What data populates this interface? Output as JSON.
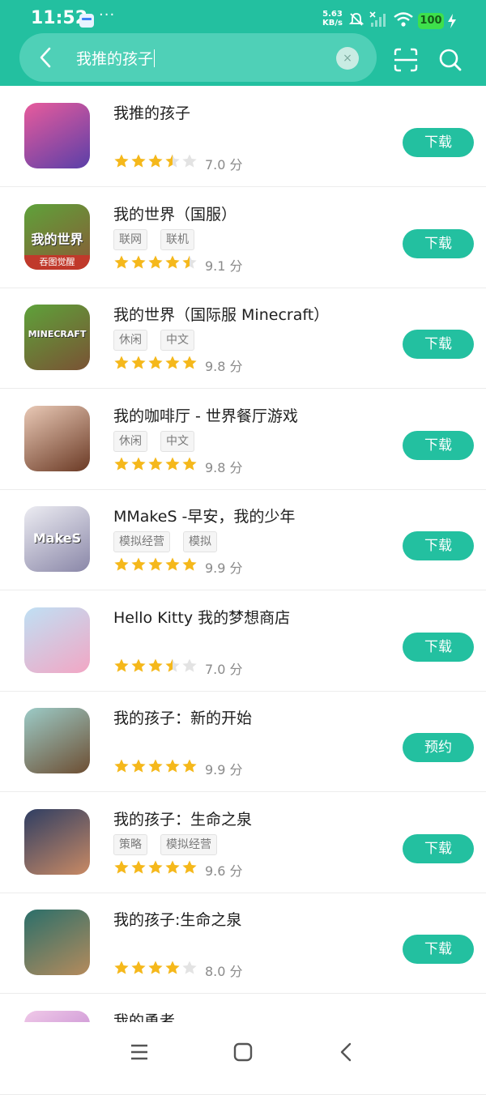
{
  "status_bar": {
    "time": "11:52",
    "dots": "···",
    "net_speed_value": "5.63",
    "net_speed_unit": "KB/s",
    "battery": "100"
  },
  "search": {
    "query": "我推的孩子",
    "clear_label": "×"
  },
  "apps": [
    {
      "name": "我推的孩子",
      "tags": [],
      "rating": 3.5,
      "score": "7.0 分",
      "button": "下载",
      "icon_colors": [
        "#e85b9c",
        "#5a3fa8"
      ]
    },
    {
      "name": "我的世界（国服）",
      "tags": [
        "联网",
        "联机"
      ],
      "rating": 4.5,
      "score": "9.1 分",
      "button": "下载",
      "icon_colors": [
        "#5ea23a",
        "#8a5a36"
      ],
      "icon_caption": "我的世界",
      "icon_badge": "吞图觉醒"
    },
    {
      "name": "我的世界（国际服 Minecraft）",
      "tags": [
        "休闲",
        "中文"
      ],
      "rating": 5,
      "score": "9.8 分",
      "button": "下载",
      "icon_colors": [
        "#5ea23a",
        "#7a5234"
      ],
      "icon_caption": "MINECRAFT"
    },
    {
      "name": "我的咖啡厅 - 世界餐厅游戏",
      "tags": [
        "休闲",
        "中文"
      ],
      "rating": 5,
      "score": "9.8 分",
      "button": "下载",
      "icon_colors": [
        "#e9c9b6",
        "#6b3a25"
      ]
    },
    {
      "name": "MMakeS -早安，我的少年",
      "tags": [
        "模拟经营",
        "模拟"
      ],
      "rating": 5,
      "score": "9.9 分",
      "button": "下载",
      "icon_colors": [
        "#ececf2",
        "#8a87a8"
      ],
      "icon_caption": "MakeS"
    },
    {
      "name": "Hello Kitty 我的梦想商店",
      "tags": [],
      "rating": 3.5,
      "score": "7.0 分",
      "button": "下载",
      "icon_colors": [
        "#bfe0f4",
        "#f2a6c4"
      ]
    },
    {
      "name": "我的孩子：新的开始",
      "tags": [],
      "rating": 5,
      "score": "9.9 分",
      "button": "预约",
      "icon_colors": [
        "#9ccbc7",
        "#6d4e32"
      ]
    },
    {
      "name": "我的孩子：生命之泉",
      "tags": [
        "策略",
        "模拟经营"
      ],
      "rating": 5,
      "score": "9.6 分",
      "button": "下载",
      "icon_colors": [
        "#2f3e63",
        "#c98a64"
      ]
    },
    {
      "name": "我的孩子:生命之泉",
      "tags": [],
      "rating": 4,
      "score": "8.0 分",
      "button": "下载",
      "icon_colors": [
        "#2b6f6a",
        "#b58b5c"
      ]
    },
    {
      "name": "我的勇者",
      "tags": [],
      "rating": 0,
      "score": "",
      "button": "",
      "icon_colors": [
        "#f0c9e8",
        "#b574c9"
      ]
    }
  ],
  "colors": {
    "accent": "#23c0a0",
    "star": "#f5b81b",
    "star_empty": "#e3e3e3"
  }
}
